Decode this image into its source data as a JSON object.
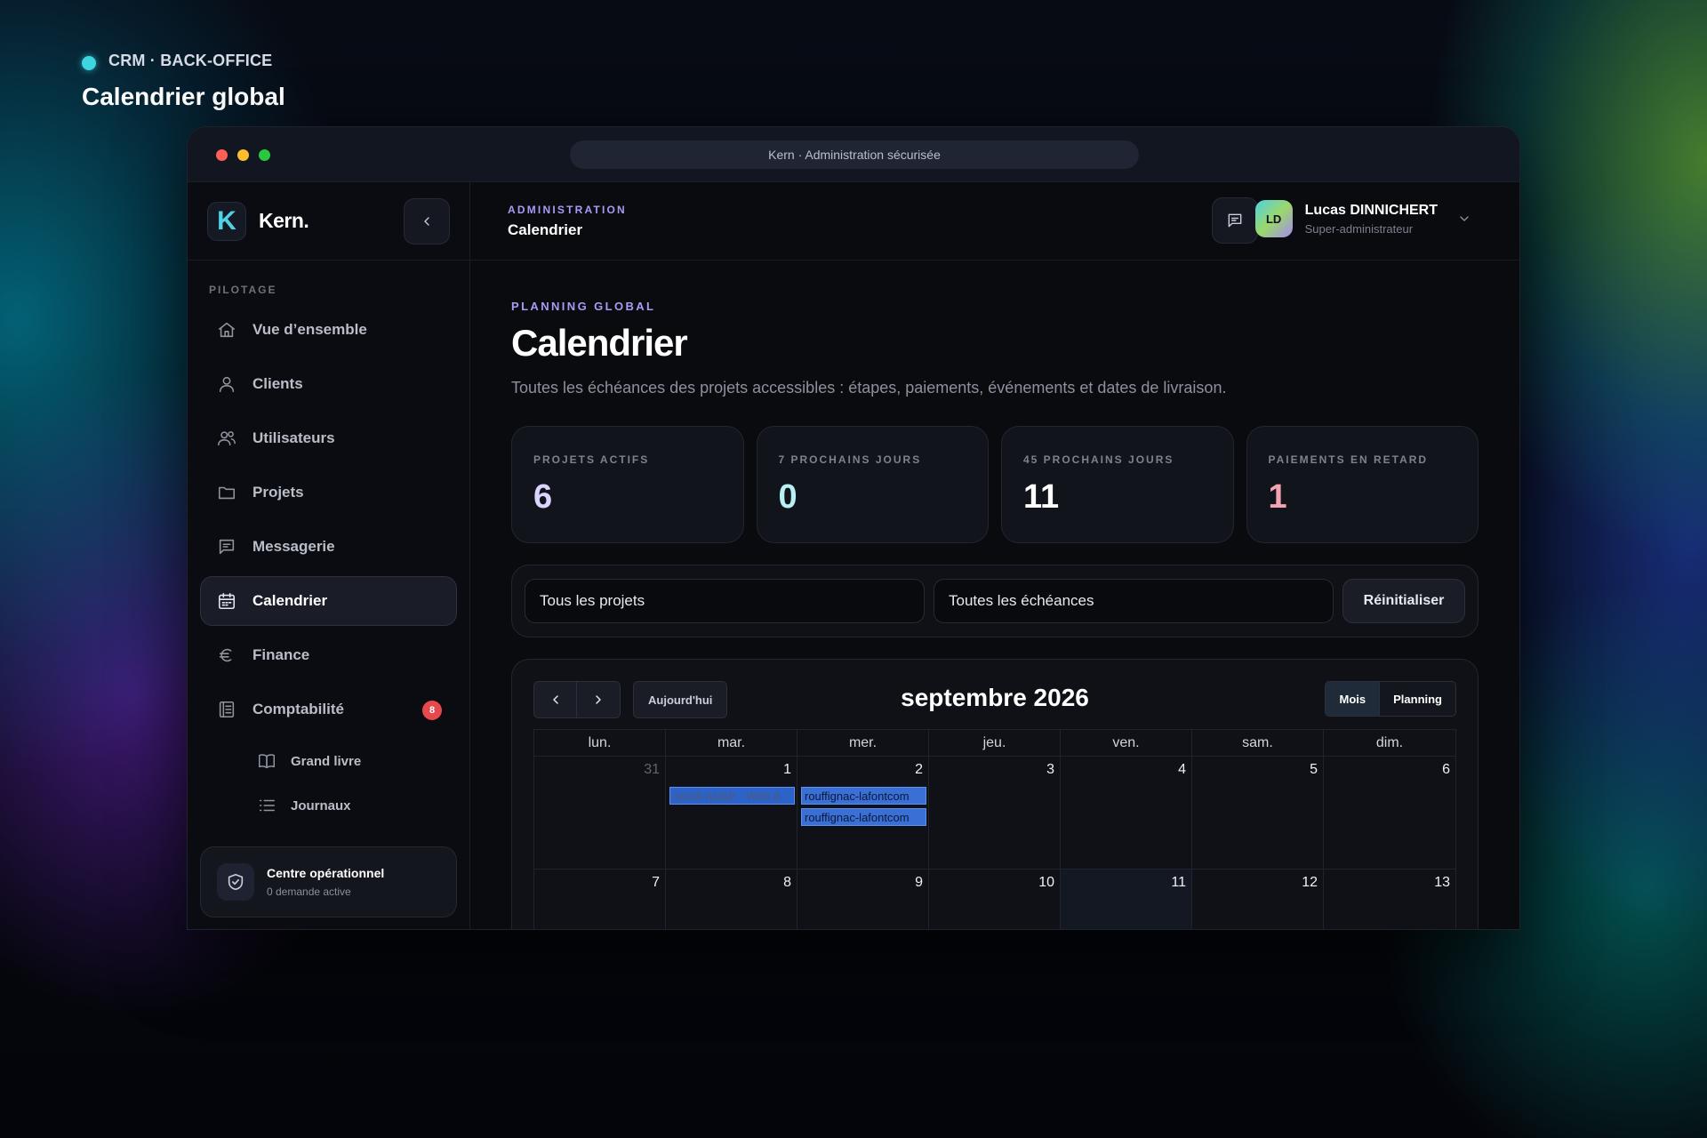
{
  "page": {
    "crumb": "CRM · BACK-OFFICE",
    "title": "Calendrier global"
  },
  "window": {
    "url_text": "Kern · Administration sécurisée"
  },
  "brand": {
    "logo_letter": "K",
    "name": "Kern."
  },
  "sidebar": {
    "section_label": "PILOTAGE",
    "items": [
      {
        "label": "Vue d’ensemble",
        "icon": "home-icon"
      },
      {
        "label": "Clients",
        "icon": "user-icon"
      },
      {
        "label": "Utilisateurs",
        "icon": "users-icon"
      },
      {
        "label": "Projets",
        "icon": "folder-icon"
      },
      {
        "label": "Messagerie",
        "icon": "chat-icon"
      },
      {
        "label": "Calendrier",
        "icon": "calendar-icon",
        "active": true
      },
      {
        "label": "Finance",
        "icon": "euro-icon"
      },
      {
        "label": "Comptabilité",
        "icon": "ledger-icon",
        "badge": "8"
      }
    ],
    "sub_items": [
      {
        "label": "Grand livre",
        "icon": "book-icon"
      },
      {
        "label": "Journaux",
        "icon": "list-icon"
      }
    ],
    "ops": {
      "title": "Centre opérationnel",
      "subtitle": "0 demande active"
    }
  },
  "topbar": {
    "kicker": "ADMINISTRATION",
    "title": "Calendrier",
    "user": {
      "initials": "LD",
      "name": "Lucas DINNICHERT",
      "role": "Super-administrateur"
    }
  },
  "content": {
    "kicker": "PLANNING GLOBAL",
    "title": "Calendrier",
    "description": "Toutes les échéances des projets accessibles : étapes, paiements, événements et dates de livraison."
  },
  "stats": [
    {
      "label": "PROJETS ACTIFS",
      "value": "6",
      "color": "#d9d4ff"
    },
    {
      "label": "7 PROCHAINS JOURS",
      "value": "0",
      "color": "#b8f0f5"
    },
    {
      "label": "45 PROCHAINS JOURS",
      "value": "11",
      "color": "#ffffff"
    },
    {
      "label": "PAIEMENTS EN RETARD",
      "value": "1",
      "color": "#f5a3b0"
    }
  ],
  "filters": {
    "project_select": "Tous les projets",
    "deadline_select": "Toutes les échéances",
    "reset_label": "Réinitialiser"
  },
  "calendar": {
    "today_label": "Aujourd'hui",
    "month_label": "septembre 2026",
    "view_month": "Mois",
    "view_planning": "Planning",
    "weekdays": [
      "lun.",
      "mar.",
      "mer.",
      "jeu.",
      "ven.",
      "sam.",
      "dim."
    ],
    "weeks": [
      [
        "31",
        "1",
        "2",
        "3",
        "4",
        "5",
        "6"
      ],
      [
        "7",
        "8",
        "9",
        "10",
        "11",
        "12",
        "13"
      ]
    ],
    "events": {
      "tue_1": "neroli-nailsfr · Web d",
      "wed_2_a": "rouffignac-lafontcom",
      "wed_2_b": "rouffignac-lafontcom"
    }
  }
}
